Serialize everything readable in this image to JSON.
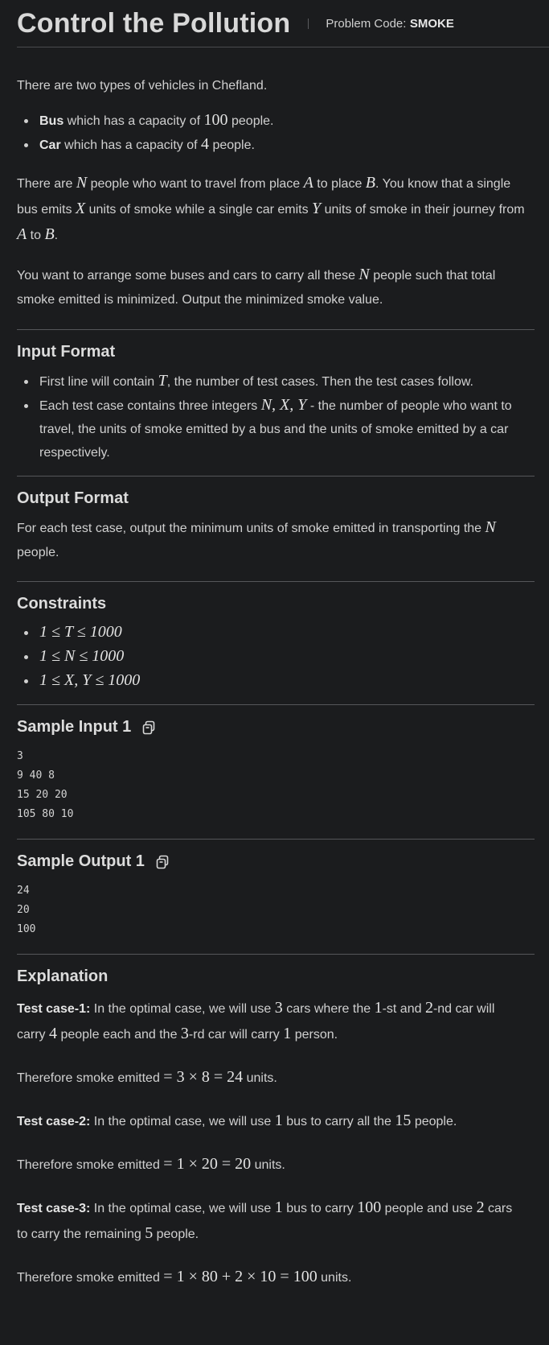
{
  "header": {
    "title": "Control the Pollution",
    "code_label": "Problem Code:",
    "code_value": "SMOKE"
  },
  "statement": {
    "intro": "There are two types of vehicles in Chefland.",
    "vehicles": [
      {
        "name": "Bus",
        "pre": " which has a capacity of ",
        "num": "100",
        "post": " people."
      },
      {
        "name": "Car",
        "pre": " which has a capacity of ",
        "num": "4",
        "post": " people."
      }
    ],
    "para2": {
      "t1": "There are ",
      "N": "N",
      "t2": " people who want to travel from place ",
      "A": "A",
      "t3": " to place ",
      "B": "B",
      "t4": ". You know that a single bus emits ",
      "X": "X",
      "t5": " units of smoke while a single car emits ",
      "Y": "Y",
      "t6": " units of smoke in their journey from ",
      "A2": "A",
      "t7": " to ",
      "B2": "B",
      "t8": "."
    },
    "para3": {
      "t1": "You want to arrange some buses and cars to carry all these ",
      "N": "N",
      "t2": " people such that total smoke emitted is minimized. Output the minimized smoke value."
    }
  },
  "input_format": {
    "heading": "Input Format",
    "item1": {
      "t1": "First line will contain ",
      "T": "T",
      "t2": ", the number of test cases. Then the test cases follow."
    },
    "item2": {
      "t1": "Each test case contains three integers ",
      "vars": "N, X, Y",
      "t2": " - the number of people who want to travel, the units of smoke emitted by a bus and the units of smoke emitted by a car respectively."
    }
  },
  "output_format": {
    "heading": "Output Format",
    "t1": "For each test case, output the minimum units of smoke emitted in transporting the ",
    "N": "N",
    "t2": " people."
  },
  "constraints": {
    "heading": "Constraints",
    "items": [
      "1 ≤ T ≤ 1000",
      "1 ≤ N ≤ 1000",
      "1 ≤ X, Y ≤ 1000"
    ]
  },
  "sample_input": {
    "heading": "Sample Input 1",
    "content": "3\n9 40 8\n15 20 20\n105 80 10"
  },
  "sample_output": {
    "heading": "Sample Output 1",
    "content": "24\n20\n100"
  },
  "explanation": {
    "heading": "Explanation",
    "case1": {
      "label": "Test case-1:",
      "t1": " In the optimal case, we will use ",
      "n1": "3",
      "t2": " cars where the ",
      "n2": "1",
      "t3": "-st and ",
      "n3": "2",
      "t4": "-nd car will carry ",
      "n4": "4",
      "t5": " people each and the ",
      "n5": "3",
      "t6": "-rd car will carry ",
      "n6": "1",
      "t7": " person."
    },
    "result1": {
      "t1": "Therefore smoke emitted ",
      "expr": "= 3 × 8 = 24",
      "t2": " units."
    },
    "case2": {
      "label": "Test case-2:",
      "t1": " In the optimal case, we will use ",
      "n1": "1",
      "t2": " bus to carry all the ",
      "n2": "15",
      "t3": " people."
    },
    "result2": {
      "t1": "Therefore smoke emitted ",
      "expr": "= 1 × 20 = 20",
      "t2": " units."
    },
    "case3": {
      "label": "Test case-3:",
      "t1": " In the optimal case, we will use ",
      "n1": "1",
      "t2": " bus to carry ",
      "n2": "100",
      "t3": " people and use ",
      "n3": "2",
      "t4": " cars to carry the remaining ",
      "n4": "5",
      "t5": " people."
    },
    "result3": {
      "t1": "Therefore smoke emitted ",
      "expr": "= 1 × 80 + 2 × 10 = 100",
      "t2": " units."
    }
  },
  "icons": {
    "copy": "copy-icon"
  }
}
